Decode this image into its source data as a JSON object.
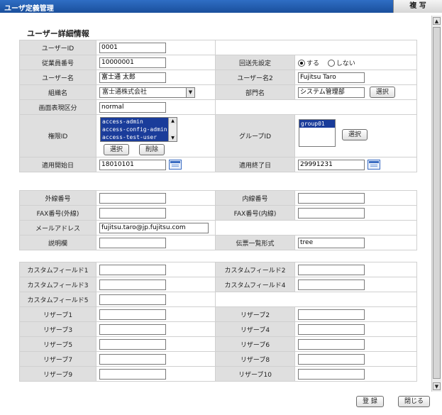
{
  "window": {
    "title": "ユーザ定義管理",
    "copy_label": "複 写"
  },
  "section_title": "ユーザー詳細情報",
  "detail": {
    "user_id": {
      "label": "ユーザーID",
      "value": "0001"
    },
    "employee_no": {
      "label": "従業員番号",
      "value": "10000001"
    },
    "forward": {
      "label": "回送先設定",
      "opt_yes": "する",
      "opt_no": "しない",
      "selected": "する"
    },
    "user_name": {
      "label": "ユーザー名",
      "value": "富士通 太郎"
    },
    "user_name2": {
      "label": "ユーザー名2",
      "value": "Fujitsu Taro"
    },
    "org": {
      "label": "組織名",
      "value": "富士通株式会社"
    },
    "dept": {
      "label": "部門名",
      "value": "システム管理部",
      "select_label": "選択"
    },
    "display_type": {
      "label": "画面表現区分",
      "value": "normal"
    },
    "roles": {
      "label": "権限ID",
      "items": [
        "access-admin",
        "access-config-admin",
        "access-test-user"
      ],
      "select_label": "選択",
      "delete_label": "削除"
    },
    "group": {
      "label": "グループID",
      "items": [
        "group01"
      ],
      "select_label": "選択"
    },
    "start_date": {
      "label": "適用開始日",
      "value": "18010101"
    },
    "end_date": {
      "label": "適用終了日",
      "value": "29991231"
    }
  },
  "contact": {
    "ext_no": {
      "label": "外線番号",
      "value": ""
    },
    "int_no": {
      "label": "内線番号",
      "value": ""
    },
    "fax_ext": {
      "label": "FAX番号(外線)",
      "value": ""
    },
    "fax_int": {
      "label": "FAX番号(内線)",
      "value": ""
    },
    "mail": {
      "label": "メールアドレス",
      "value": "fujitsu.taro@jp.fujitsu.com"
    },
    "desc": {
      "label": "説明欄",
      "value": ""
    },
    "slip": {
      "label": "伝票一覧形式",
      "value": "tree"
    }
  },
  "custom": {
    "cf1": {
      "label": "カスタムフィールド1",
      "value": ""
    },
    "cf2": {
      "label": "カスタムフィールド2",
      "value": ""
    },
    "cf3": {
      "label": "カスタムフィールド3",
      "value": ""
    },
    "cf4": {
      "label": "カスタムフィールド4",
      "value": ""
    },
    "cf5": {
      "label": "カスタムフィールド5",
      "value": ""
    },
    "r1": {
      "label": "リザーブ1",
      "value": ""
    },
    "r2": {
      "label": "リザーブ2",
      "value": ""
    },
    "r3": {
      "label": "リザーブ3",
      "value": ""
    },
    "r4": {
      "label": "リザーブ4",
      "value": ""
    },
    "r5": {
      "label": "リザーブ5",
      "value": ""
    },
    "r6": {
      "label": "リザーブ6",
      "value": ""
    },
    "r7": {
      "label": "リザーブ7",
      "value": ""
    },
    "r8": {
      "label": "リザーブ8",
      "value": ""
    },
    "r9": {
      "label": "リザーブ9",
      "value": ""
    },
    "r10": {
      "label": "リザーブ10",
      "value": ""
    }
  },
  "footer": {
    "register_label": "登 録",
    "close_label": "閉じる"
  },
  "colors": {
    "titlebar": "#1a4f9c",
    "label_bg": "#dfdfdf",
    "selection": "#1a3c9a"
  }
}
